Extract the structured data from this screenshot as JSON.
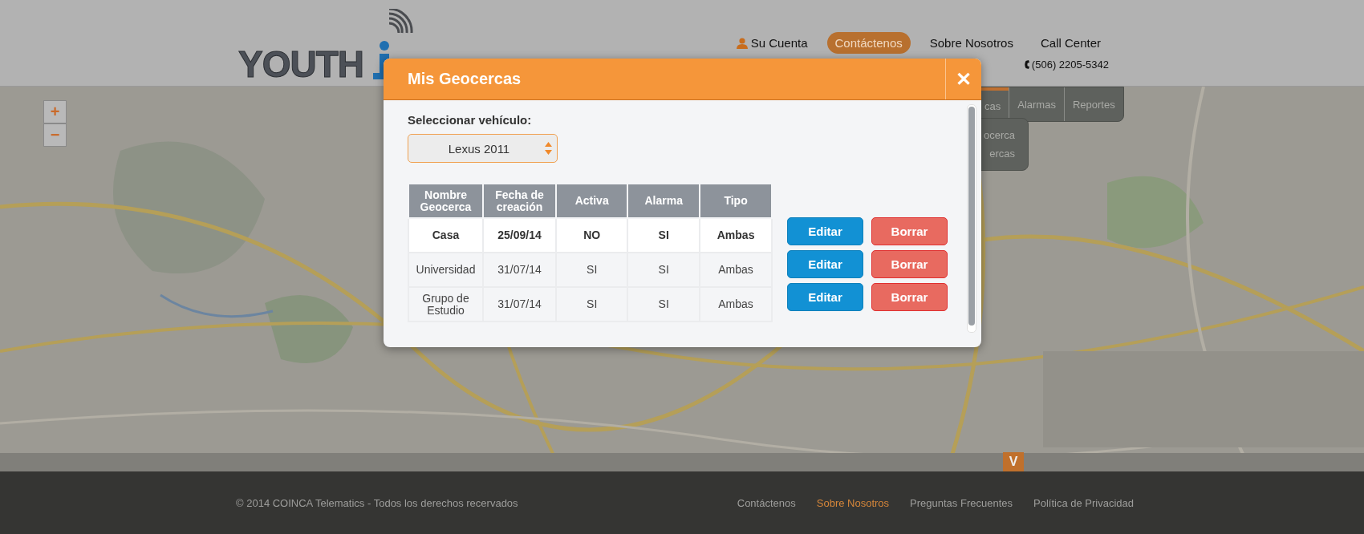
{
  "logo": {
    "word_1": "YOUTH"
  },
  "nav": [
    {
      "label": "Su Cuenta",
      "kind": "account",
      "selected": false
    },
    {
      "label": "Contáctenos",
      "kind": "link",
      "selected": true
    },
    {
      "label": "Sobre Nosotros",
      "kind": "link",
      "selected": false
    },
    {
      "label": "Call Center",
      "kind": "link",
      "selected": false
    }
  ],
  "call_center_phone": "(506) 2205-5342",
  "map": {
    "kind": "picture",
    "zoom_controls": [
      "+",
      "−"
    ],
    "menu_tabs": [
      {
        "label": "cas",
        "selected": true
      },
      {
        "label": "Alarmas",
        "selected": false
      },
      {
        "label": "Reportes",
        "selected": false
      }
    ],
    "submenu": [
      "ocerca",
      "ercas"
    ],
    "expand_button": "V"
  },
  "modal": {
    "title": "Mis Geocercas",
    "close": "✕",
    "vehicle_label": "Seleccionar vehículo:",
    "vehicle_value": "Lexus 2011",
    "columns": [
      "Nombre Geocerca",
      "Fecha de creación",
      "Activa",
      "Alarma",
      "Tipo"
    ],
    "rows": [
      {
        "cells": [
          "Casa",
          "25/09/14",
          "NO",
          "SI",
          "Ambas"
        ],
        "selected": true,
        "edit_button": "Editar",
        "delete_button": "Borrar"
      },
      {
        "cells": [
          "Universidad",
          "31/07/14",
          "SI",
          "SI",
          "Ambas"
        ],
        "selected": false,
        "edit_button": "Editar",
        "delete_button": "Borrar"
      },
      {
        "cells": [
          "Grupo de Estudio",
          "31/07/14",
          "SI",
          "SI",
          "Ambas"
        ],
        "selected": false,
        "edit_button": "Editar",
        "delete_button": "Borrar"
      }
    ]
  },
  "footer": {
    "copyright": "© 2014 COINCA Telematics - Todos los derechos recervados",
    "links": [
      {
        "label": "Contáctenos",
        "selected": false
      },
      {
        "label": "Sobre Nosotros",
        "selected": true
      },
      {
        "label": "Preguntas Frecuentes",
        "selected": false
      },
      {
        "label": "Política de Privacidad",
        "selected": false
      }
    ]
  }
}
